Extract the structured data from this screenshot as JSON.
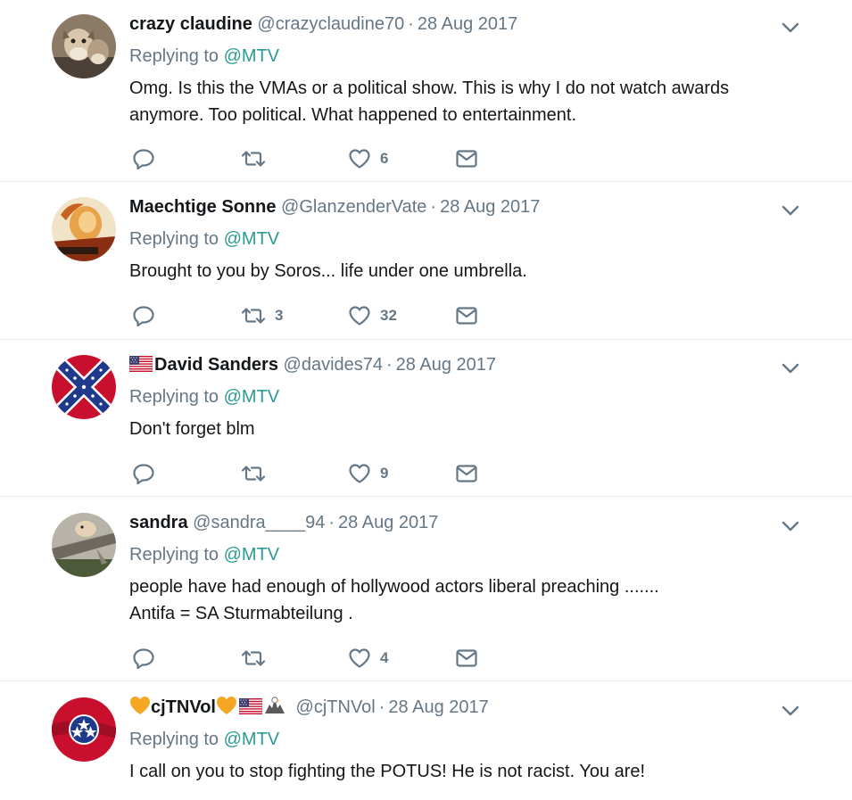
{
  "tweets": [
    {
      "name": "crazy claudine",
      "handle": "@crazyclaudine70",
      "date": "28 Aug 2017",
      "replying_prefix": "Replying to",
      "mention": "@MTV",
      "text_lines": [
        "Omg. Is this the VMAs or a political show.  This is why I do not watch awards",
        "anymore.  Too political.  What happened to entertainment."
      ],
      "retweets": "",
      "likes": "6",
      "avatar": "dog-photo"
    },
    {
      "name": "Maechtige Sonne",
      "handle": "@GlanzenderVate",
      "date": "28 Aug 2017",
      "replying_prefix": "Replying to",
      "mention": "@MTV",
      "text_lines": [
        "Brought to you by Soros... life under one umbrella."
      ],
      "retweets": "3",
      "likes": "32",
      "avatar": "cartoon-photo"
    },
    {
      "name": "David Sanders",
      "handle": "@davides74",
      "date": "28 Aug 2017",
      "replying_prefix": "Replying to",
      "mention": "@MTV",
      "text_lines": [
        "Don't forget blm"
      ],
      "retweets": "",
      "likes": "9",
      "avatar": "confederate-flag"
    },
    {
      "name": "sandra",
      "handle": "@sandra____94",
      "date": "28 Aug 2017",
      "replying_prefix": "Replying to",
      "mention": "@MTV",
      "text_lines": [
        "people have had enough of hollywood actors liberal preaching .......",
        "Antifa = SA Sturmabteilung ."
      ],
      "retweets": "",
      "likes": "4",
      "avatar": "hamster-photo"
    },
    {
      "name": "cjTNVol",
      "handle": "@cjTNVol",
      "date": "28 Aug 2017",
      "replying_prefix": "Replying to",
      "mention": "@MTV",
      "text_lines": [
        "I call on you to stop fighting the POTUS! He is not racist. You are!"
      ],
      "avatar": "tennessee-flag"
    }
  ],
  "separator": "·",
  "colors": {
    "name": "#14171a",
    "secondary": "#657786",
    "mention": "#2a9a93",
    "divider": "#e6ecf0"
  },
  "icons": [
    "reply-icon",
    "retweet-icon",
    "like-icon",
    "direct-message-icon",
    "chevron-down-icon",
    "us-flag-emoji",
    "orange-heart-emoji",
    "eagle-emoji"
  ]
}
